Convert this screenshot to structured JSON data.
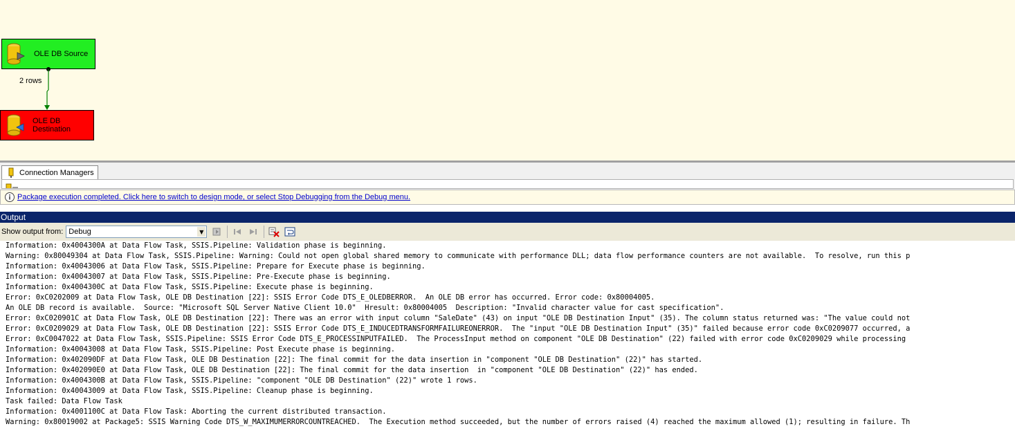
{
  "canvas": {
    "source_label": "OLE DB Source",
    "destination_label": "OLE DB\nDestination",
    "path_label": "2 rows",
    "source_color": "#22ee22",
    "destination_color": "#ff0000"
  },
  "connection_managers": {
    "tab_label": "Connection Managers"
  },
  "info_bar": {
    "icon": "info-icon",
    "message": "Package execution completed. Click here to switch to design mode, or select Stop Debugging from the Debug menu."
  },
  "output": {
    "title": "Output",
    "show_output_label": "Show output from:",
    "show_output_value": "Debug",
    "lines": [
      "Information: 0x4004300A at Data Flow Task, SSIS.Pipeline: Validation phase is beginning.",
      "Warning: 0x80049304 at Data Flow Task, SSIS.Pipeline: Warning: Could not open global shared memory to communicate with performance DLL; data flow performance counters are not available.  To resolve, run this p",
      "Information: 0x40043006 at Data Flow Task, SSIS.Pipeline: Prepare for Execute phase is beginning.",
      "Information: 0x40043007 at Data Flow Task, SSIS.Pipeline: Pre-Execute phase is beginning.",
      "Information: 0x4004300C at Data Flow Task, SSIS.Pipeline: Execute phase is beginning.",
      "Error: 0xC0202009 at Data Flow Task, OLE DB Destination [22]: SSIS Error Code DTS_E_OLEDBERROR.  An OLE DB error has occurred. Error code: 0x80004005.",
      "An OLE DB record is available.  Source: \"Microsoft SQL Server Native Client 10.0\"  Hresult: 0x80004005  Description: \"Invalid character value for cast specification\".",
      "Error: 0xC020901C at Data Flow Task, OLE DB Destination [22]: There was an error with input column \"SaleDate\" (43) on input \"OLE DB Destination Input\" (35). The column status returned was: \"The value could not",
      "Error: 0xC0209029 at Data Flow Task, OLE DB Destination [22]: SSIS Error Code DTS_E_INDUCEDTRANSFORMFAILUREONERROR.  The \"input \"OLE DB Destination Input\" (35)\" failed because error code 0xC0209077 occurred, a",
      "Error: 0xC0047022 at Data Flow Task, SSIS.Pipeline: SSIS Error Code DTS_E_PROCESSINPUTFAILED.  The ProcessInput method on component \"OLE DB Destination\" (22) failed with error code 0xC0209029 while processing",
      "Information: 0x40043008 at Data Flow Task, SSIS.Pipeline: Post Execute phase is beginning.",
      "Information: 0x402090DF at Data Flow Task, OLE DB Destination [22]: The final commit for the data insertion in \"component \"OLE DB Destination\" (22)\" has started.",
      "Information: 0x402090E0 at Data Flow Task, OLE DB Destination [22]: The final commit for the data insertion  in \"component \"OLE DB Destination\" (22)\" has ended.",
      "Information: 0x4004300B at Data Flow Task, SSIS.Pipeline: \"component \"OLE DB Destination\" (22)\" wrote 1 rows.",
      "Information: 0x40043009 at Data Flow Task, SSIS.Pipeline: Cleanup phase is beginning.",
      "Task failed: Data Flow Task",
      "Information: 0x4001100C at Data Flow Task: Aborting the current distributed transaction.",
      "Warning: 0x80019002 at Package5: SSIS Warning Code DTS_W_MAXIMUMERRORCOUNTREACHED.  The Execution method succeeded, but the number of errors raised (4) reached the maximum allowed (1); resulting in failure. Th"
    ]
  }
}
